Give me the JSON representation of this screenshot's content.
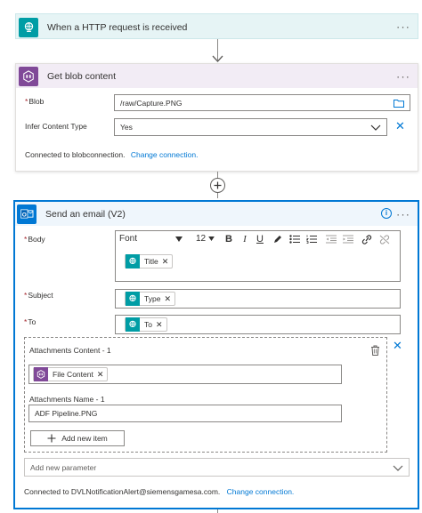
{
  "trigger": {
    "title": "When a HTTP request is received"
  },
  "blob_action": {
    "title": "Get blob content",
    "blob_label": "Blob",
    "blob_value": "/raw/Capture.PNG",
    "infer_label": "Infer Content Type",
    "infer_value": "Yes",
    "connected_text": "Connected to blobconnection.",
    "change_connection": "Change connection."
  },
  "email_action": {
    "title": "Send an email (V2)",
    "body_label": "Body",
    "font_value": "Font",
    "font_size": "12",
    "body_token": "Title",
    "subject_label": "Subject",
    "subject_token": "Type",
    "to_label": "To",
    "to_token": "To",
    "attach_content_label": "Attachments Content - 1",
    "attach_content_token": "File Content",
    "attach_name_label": "Attachments Name - 1",
    "attach_name_value": "ADF Pipeline.PNG",
    "add_item_label": "Add new item",
    "add_param_placeholder": "Add new parameter",
    "connected_text": "Connected to DVLNotificationAlert@siemensgamesa.com.",
    "change_connection": "Change connection."
  },
  "colors": {
    "trigger_accent": "#009da5",
    "trigger_bg": "#e6f4f5",
    "blob_accent": "#804998",
    "blob_bg": "#f2ecf5",
    "email_accent": "#0078d4",
    "email_bg": "#eff6fc",
    "link": "#0078d4"
  },
  "icons": {
    "trigger": "globe-request-icon",
    "blob": "azure-blob-icon",
    "email": "outlook-icon",
    "more": "ellipsis-icon",
    "info": "info-icon",
    "folder": "folder-icon",
    "chevron": "chevron-down-icon",
    "close": "close-icon",
    "add_step": "plus-circle-icon",
    "delete": "trash-icon"
  }
}
